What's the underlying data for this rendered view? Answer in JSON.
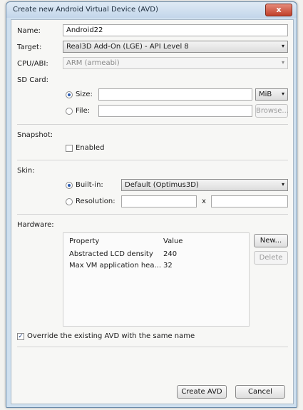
{
  "window": {
    "title": "Create new Android Virtual Device (AVD)",
    "close_glyph": "x"
  },
  "labels": {
    "name": "Name:",
    "target": "Target:",
    "cpu": "CPU/ABI:",
    "sdcard": "SD Card:",
    "snapshot": "Snapshot:",
    "skin": "Skin:",
    "hardware": "Hardware:"
  },
  "name_value": "Android22",
  "target_value": "Real3D Add-On (LGE) - API Level 8",
  "cpu_value": "ARM (armeabi)",
  "sdcard": {
    "size_label": "Size:",
    "size_value": "",
    "unit": "MiB",
    "file_label": "File:",
    "file_value": "",
    "browse_label": "Browse..."
  },
  "snapshot": {
    "enabled_label": "Enabled"
  },
  "skin": {
    "builtin_label": "Built-in:",
    "builtin_value": "Default (Optimus3D)",
    "resolution_label": "Resolution:",
    "res_x": "",
    "res_sep": "x",
    "res_y": ""
  },
  "hardware": {
    "columns": [
      "Property",
      "Value"
    ],
    "rows": [
      {
        "property": "Abstracted LCD density",
        "value": "240"
      },
      {
        "property": "Max VM application hea...",
        "value": "32"
      }
    ],
    "new_label": "New...",
    "delete_label": "Delete"
  },
  "override_label": "Override the existing AVD with the same name",
  "buttons": {
    "create": "Create AVD",
    "cancel": "Cancel"
  },
  "icons": {
    "dropdown": "▾",
    "check": "✓"
  }
}
